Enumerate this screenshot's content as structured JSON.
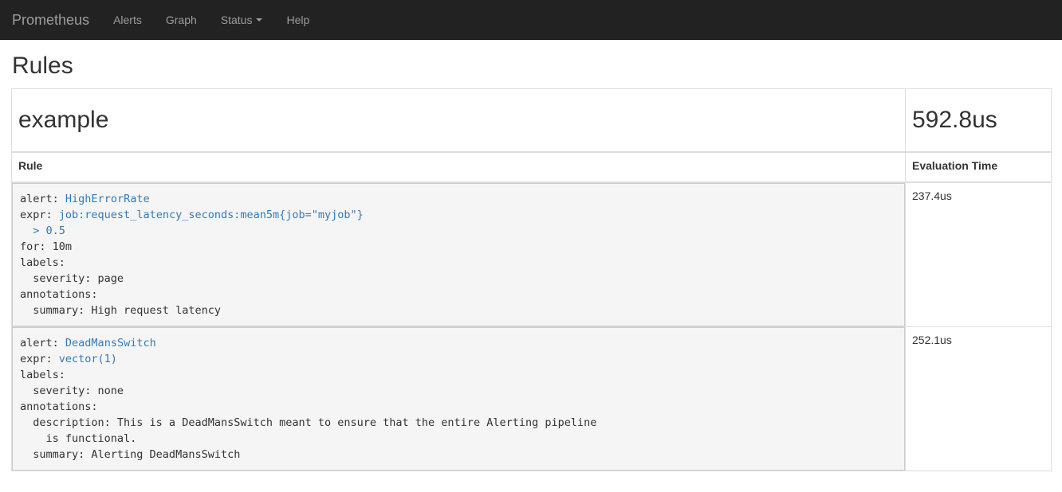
{
  "nav": {
    "brand": "Prometheus",
    "items": [
      "Alerts",
      "Graph",
      "Status",
      "Help"
    ]
  },
  "page": {
    "title": "Rules"
  },
  "group": {
    "name": "example",
    "evaluation_time": "592.8us"
  },
  "table": {
    "col_rule": "Rule",
    "col_eval": "Evaluation Time"
  },
  "rules": [
    {
      "alert_key": "alert:",
      "alert_name": "HighErrorRate",
      "expr_key": "expr:",
      "expr_line1": "job:request_latency_seconds:mean5m{job=\"myjob\"}",
      "expr_line2": "  > 0.5",
      "for_line": "for: 10m",
      "labels_key": "labels:",
      "label_line": "  severity: page",
      "annotations_key": "annotations:",
      "annotation_line1": "  summary: High request latency",
      "eval_time": "237.4us"
    },
    {
      "alert_key": "alert:",
      "alert_name": "DeadMansSwitch",
      "expr_key": "expr:",
      "expr_line1": "vector(1)",
      "labels_key": "labels:",
      "label_line": "  severity: none",
      "annotations_key": "annotations:",
      "annotation_line1": "  description: This is a DeadMansSwitch meant to ensure that the entire Alerting pipeline",
      "annotation_line2": "    is functional.",
      "annotation_line3": "  summary: Alerting DeadMansSwitch",
      "eval_time": "252.1us"
    }
  ],
  "colors": {
    "navbar_bg": "#222222",
    "nav_text": "#9d9d9d",
    "link": "#337ab7",
    "code_bg": "#f5f5f5"
  }
}
